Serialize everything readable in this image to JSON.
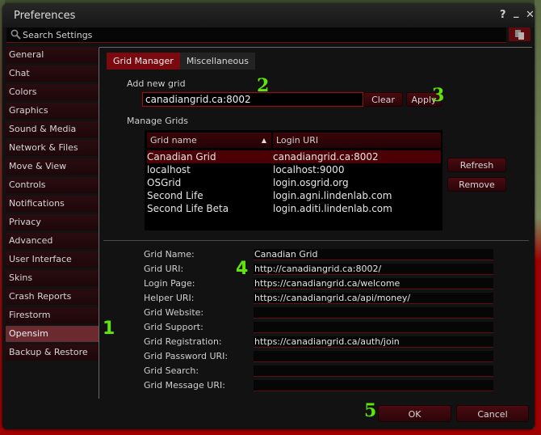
{
  "window": {
    "title": "Preferences",
    "help_icon": "question-mark-icon",
    "minimize_icon": "minimize-icon",
    "close_icon": "close-icon"
  },
  "search": {
    "placeholder": "Search Settings",
    "value": "",
    "icon": "magnifier-icon",
    "copy_icon": "copy-pages-icon"
  },
  "sidebar": {
    "items": [
      {
        "label": "General"
      },
      {
        "label": "Chat"
      },
      {
        "label": "Colors"
      },
      {
        "label": "Graphics"
      },
      {
        "label": "Sound & Media"
      },
      {
        "label": "Network & Files"
      },
      {
        "label": "Move & View"
      },
      {
        "label": "Controls"
      },
      {
        "label": "Notifications"
      },
      {
        "label": "Privacy"
      },
      {
        "label": "Advanced"
      },
      {
        "label": "User Interface"
      },
      {
        "label": "Skins"
      },
      {
        "label": "Crash Reports"
      },
      {
        "label": "Firestorm"
      },
      {
        "label": "Opensim"
      },
      {
        "label": "Backup & Restore"
      }
    ],
    "active": "Opensim"
  },
  "tabs": [
    {
      "label": "Grid Manager",
      "active": true
    },
    {
      "label": "Miscellaneous",
      "active": false
    }
  ],
  "grid_manager": {
    "add_label": "Add new grid",
    "add_value": "canadiangrid.ca:8002",
    "clear_label": "Clear",
    "apply_label": "Apply",
    "manage_label": "Manage Grids",
    "columns": [
      "Grid name",
      "Login URI"
    ],
    "sort_indicator": "▲",
    "rows": [
      {
        "name": "Canadian Grid",
        "uri": "canadiangrid.ca:8002",
        "selected": true
      },
      {
        "name": "localhost",
        "uri": "localhost:9000",
        "selected": false
      },
      {
        "name": "OSGrid",
        "uri": "login.osgrid.org",
        "selected": false
      },
      {
        "name": "Second Life",
        "uri": "login.agni.lindenlab.com",
        "selected": false
      },
      {
        "name": "Second Life Beta",
        "uri": "login.aditi.lindenlab.com",
        "selected": false
      }
    ],
    "refresh_label": "Refresh",
    "remove_label": "Remove"
  },
  "details": {
    "fields": [
      {
        "label": "Grid Name:",
        "value": "Canadian Grid"
      },
      {
        "label": "Grid URI:",
        "value": "http://canadiangrid.ca:8002/"
      },
      {
        "label": "Login Page:",
        "value": "https://canadiangrid.ca/welcome"
      },
      {
        "label": "Helper URI:",
        "value": "https://canadiangrid.ca/api/money/"
      },
      {
        "label": "Grid Website:",
        "value": ""
      },
      {
        "label": "Grid Support:",
        "value": ""
      },
      {
        "label": "Grid Registration:",
        "value": "https://canadiangrid.ca/auth/join"
      },
      {
        "label": "Grid Password URI:",
        "value": ""
      },
      {
        "label": "Grid Search:",
        "value": ""
      },
      {
        "label": "Grid Message URI:",
        "value": ""
      }
    ]
  },
  "footer": {
    "ok_label": "OK",
    "cancel_label": "Cancel"
  },
  "annotations": [
    "1",
    "2",
    "3",
    "4",
    "5"
  ],
  "colors": {
    "accent": "#7a0a10",
    "selected_row": "#4a0005",
    "annotation": "#5ee60a"
  }
}
